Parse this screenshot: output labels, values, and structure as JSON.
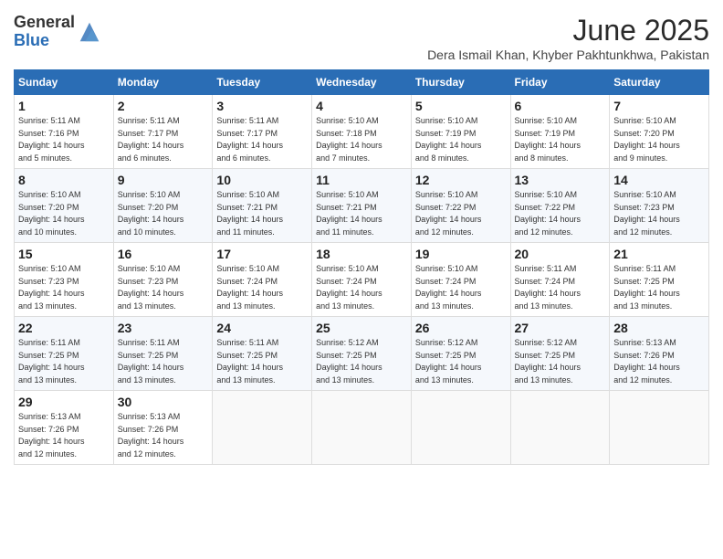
{
  "header": {
    "logo_general": "General",
    "logo_blue": "Blue",
    "month_title": "June 2025",
    "subtitle": "Dera Ismail Khan, Khyber Pakhtunkhwa, Pakistan"
  },
  "calendar": {
    "days_of_week": [
      "Sunday",
      "Monday",
      "Tuesday",
      "Wednesday",
      "Thursday",
      "Friday",
      "Saturday"
    ],
    "weeks": [
      [
        null,
        {
          "day": 2,
          "sunrise": "5:11 AM",
          "sunset": "7:17 PM",
          "daylight": "14 hours and 6 minutes."
        },
        {
          "day": 3,
          "sunrise": "5:11 AM",
          "sunset": "7:17 PM",
          "daylight": "14 hours and 6 minutes."
        },
        {
          "day": 4,
          "sunrise": "5:10 AM",
          "sunset": "7:18 PM",
          "daylight": "14 hours and 7 minutes."
        },
        {
          "day": 5,
          "sunrise": "5:10 AM",
          "sunset": "7:19 PM",
          "daylight": "14 hours and 8 minutes."
        },
        {
          "day": 6,
          "sunrise": "5:10 AM",
          "sunset": "7:19 PM",
          "daylight": "14 hours and 8 minutes."
        },
        {
          "day": 7,
          "sunrise": "5:10 AM",
          "sunset": "7:20 PM",
          "daylight": "14 hours and 9 minutes."
        }
      ],
      [
        {
          "day": 8,
          "sunrise": "5:10 AM",
          "sunset": "7:20 PM",
          "daylight": "14 hours and 10 minutes."
        },
        {
          "day": 9,
          "sunrise": "5:10 AM",
          "sunset": "7:20 PM",
          "daylight": "14 hours and 10 minutes."
        },
        {
          "day": 10,
          "sunrise": "5:10 AM",
          "sunset": "7:21 PM",
          "daylight": "14 hours and 11 minutes."
        },
        {
          "day": 11,
          "sunrise": "5:10 AM",
          "sunset": "7:21 PM",
          "daylight": "14 hours and 11 minutes."
        },
        {
          "day": 12,
          "sunrise": "5:10 AM",
          "sunset": "7:22 PM",
          "daylight": "14 hours and 12 minutes."
        },
        {
          "day": 13,
          "sunrise": "5:10 AM",
          "sunset": "7:22 PM",
          "daylight": "14 hours and 12 minutes."
        },
        {
          "day": 14,
          "sunrise": "5:10 AM",
          "sunset": "7:23 PM",
          "daylight": "14 hours and 12 minutes."
        }
      ],
      [
        {
          "day": 15,
          "sunrise": "5:10 AM",
          "sunset": "7:23 PM",
          "daylight": "14 hours and 13 minutes."
        },
        {
          "day": 16,
          "sunrise": "5:10 AM",
          "sunset": "7:23 PM",
          "daylight": "14 hours and 13 minutes."
        },
        {
          "day": 17,
          "sunrise": "5:10 AM",
          "sunset": "7:24 PM",
          "daylight": "14 hours and 13 minutes."
        },
        {
          "day": 18,
          "sunrise": "5:10 AM",
          "sunset": "7:24 PM",
          "daylight": "14 hours and 13 minutes."
        },
        {
          "day": 19,
          "sunrise": "5:10 AM",
          "sunset": "7:24 PM",
          "daylight": "14 hours and 13 minutes."
        },
        {
          "day": 20,
          "sunrise": "5:11 AM",
          "sunset": "7:24 PM",
          "daylight": "14 hours and 13 minutes."
        },
        {
          "day": 21,
          "sunrise": "5:11 AM",
          "sunset": "7:25 PM",
          "daylight": "14 hours and 13 minutes."
        }
      ],
      [
        {
          "day": 22,
          "sunrise": "5:11 AM",
          "sunset": "7:25 PM",
          "daylight": "14 hours and 13 minutes."
        },
        {
          "day": 23,
          "sunrise": "5:11 AM",
          "sunset": "7:25 PM",
          "daylight": "14 hours and 13 minutes."
        },
        {
          "day": 24,
          "sunrise": "5:11 AM",
          "sunset": "7:25 PM",
          "daylight": "14 hours and 13 minutes."
        },
        {
          "day": 25,
          "sunrise": "5:12 AM",
          "sunset": "7:25 PM",
          "daylight": "14 hours and 13 minutes."
        },
        {
          "day": 26,
          "sunrise": "5:12 AM",
          "sunset": "7:25 PM",
          "daylight": "14 hours and 13 minutes."
        },
        {
          "day": 27,
          "sunrise": "5:12 AM",
          "sunset": "7:25 PM",
          "daylight": "14 hours and 13 minutes."
        },
        {
          "day": 28,
          "sunrise": "5:13 AM",
          "sunset": "7:26 PM",
          "daylight": "14 hours and 12 minutes."
        }
      ],
      [
        {
          "day": 29,
          "sunrise": "5:13 AM",
          "sunset": "7:26 PM",
          "daylight": "14 hours and 12 minutes."
        },
        {
          "day": 30,
          "sunrise": "5:13 AM",
          "sunset": "7:26 PM",
          "daylight": "14 hours and 12 minutes."
        },
        null,
        null,
        null,
        null,
        null
      ]
    ],
    "week1_day1": {
      "day": 1,
      "sunrise": "5:11 AM",
      "sunset": "7:16 PM",
      "daylight": "14 hours and 5 minutes."
    }
  },
  "labels": {
    "sunrise_label": "Sunrise:",
    "sunset_label": "Sunset:",
    "daylight_label": "Daylight:"
  }
}
